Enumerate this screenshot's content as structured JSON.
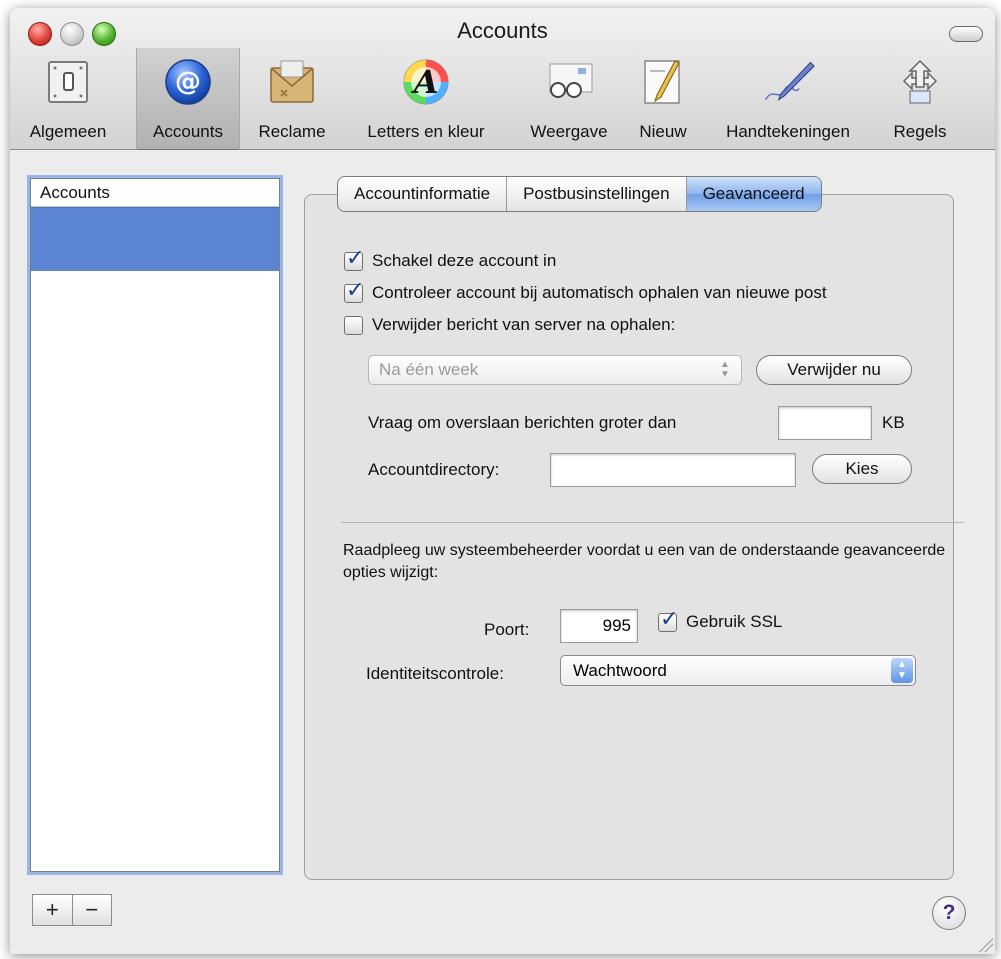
{
  "window": {
    "title": "Accounts"
  },
  "toolbar": {
    "items": [
      {
        "label": "Algemeen",
        "icon": "switch-icon"
      },
      {
        "label": "Accounts",
        "icon": "at-sign-icon"
      },
      {
        "label": "Reclame",
        "icon": "junk-mail-icon"
      },
      {
        "label": "Letters en kleur",
        "icon": "fonts-colors-icon"
      },
      {
        "label": "Weergave",
        "icon": "glasses-icon"
      },
      {
        "label": "Nieuw",
        "icon": "compose-icon"
      },
      {
        "label": "Handtekeningen",
        "icon": "signature-pen-icon"
      },
      {
        "label": "Regels",
        "icon": "rules-icon"
      }
    ],
    "selected": "Accounts"
  },
  "accounts_list": {
    "header": "Accounts"
  },
  "list_controls": {
    "add": "+",
    "remove": "−"
  },
  "tabs": [
    {
      "label": "Accountinformatie"
    },
    {
      "label": "Postbusinstellingen"
    },
    {
      "label": "Geavanceerd"
    }
  ],
  "advanced": {
    "enable_account": {
      "label": "Schakel deze account in",
      "checked": true
    },
    "include_auto": {
      "label": "Controleer account bij automatisch ophalen van nieuwe post",
      "checked": true
    },
    "remove_copy": {
      "label": "Verwijder bericht van server na ophalen:",
      "checked": false
    },
    "remove_after": {
      "value": "Na één week"
    },
    "remove_now_button": "Verwijder nu",
    "prompt_size_label": "Vraag om overslaan berichten groter dan",
    "prompt_size_value": "",
    "prompt_size_unit": "KB",
    "account_dir_label": "Accountdirectory:",
    "account_dir_value": "",
    "choose_button": "Kies",
    "note": "Raadpleeg uw systeembeheerder voordat u een van de onderstaande geavanceerde opties wijzigt:",
    "port_label": "Poort:",
    "port_value": "995",
    "ssl": {
      "label": "Gebruik SSL",
      "checked": true
    },
    "auth_label": "Identiteitscontrole:",
    "auth_value": "Wachtwoord"
  },
  "help": "?",
  "colors": {
    "selection": "#5b84d3",
    "focus_ring": "#95b6e6",
    "check": "#1b3f8f"
  }
}
